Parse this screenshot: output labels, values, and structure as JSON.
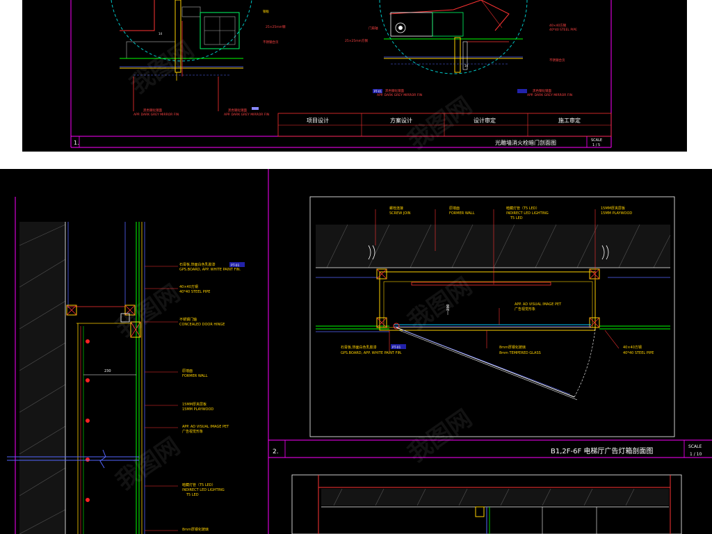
{
  "top_panel": {
    "detail_number": "1.",
    "title": "光雕墙消火栓暗门剖面图",
    "scale_label": "SCALE",
    "scale_value": "1 / 5",
    "sign_cells": [
      "项目设计",
      "方案设计",
      "设计审定",
      "施工审定"
    ],
    "left_circle": {
      "dim_14": "14",
      "dim_25": "25×25mm钢",
      "note_r1": "钢板",
      "note_r2": "不锈钢合页",
      "bottom_tag_cn": "黑色钢化镜面",
      "bottom_tag_en": "APP. DARK GREY MIRROR FIN",
      "bottom_tag_cn_2": "黑色钢化镜面",
      "bottom_tag_en_2": "APP. DARK GREY MIRROR FIN"
    },
    "right_circle": {
      "note_l1": "门扇轴",
      "note_l2": "25×25mm方钢",
      "note_r1_cn": "40×40方钢",
      "note_r1_en": "40*40 STEEL PIPE",
      "note_r2": "不锈钢合页",
      "dim_14": "14",
      "tag_left": "PT-01",
      "bottom_tag_cn": "黑色钢化镜面",
      "bottom_tag_en": "APP. DARK GREY MIRROR FIN",
      "bottom_tag_cn_2": "黑色钢化镜面",
      "bottom_tag_en_2": "APP. DARK GREY MIRROR FIN"
    }
  },
  "bottom_left_panel": {
    "notes": [
      {
        "cn": "石膏板,饰面白色乳胶漆",
        "tag": "PT-01",
        "en": "GPS.BOARD, APP. WHITE PAINT FIN."
      },
      {
        "cn": "40×40方钢",
        "en": "40*40 STEEL PIPE"
      },
      {
        "cn": "不锈钢门轴",
        "en": "CONCEALED DOOR HINGE"
      },
      {
        "cn": "原墙面",
        "en": "FORMER WALL"
      },
      {
        "cn": "15MM厚夹层板",
        "en": "15MM PLAYWOOD"
      },
      {
        "cn": "APP. AD VISUAL IMAGE  PET",
        "en": "广告视觉形象"
      },
      {
        "cn": "暗藏灯管（T5 LED）",
        "en": "INDIRECT LED LIGHTING",
        "en2": "T5 LED"
      },
      {
        "cn": "8mm厚钢化玻璃",
        "en": ""
      }
    ],
    "dim_230": "230"
  },
  "bottom_right_panel": {
    "top_notes": [
      {
        "cn": "螺栓连接",
        "en": "SCREW JOIN"
      },
      {
        "cn": "原墙面",
        "en": "FORMER WALL"
      },
      {
        "cn": "暗藏灯管（T5 LED）",
        "en": "INDIRECT LED LIGHTING",
        "en2": "T5 LED"
      },
      {
        "cn": "15MM厚夹层板",
        "en": "15MM PLAYWOOD"
      }
    ],
    "mid_note": {
      "cn": "APP. AD VISUAL IMAGE  PET",
      "en": "广告视觉形象"
    },
    "dim_230": "230",
    "bottom_notes": [
      {
        "cn": "石膏板,饰面白色乳胶漆",
        "tag": "PT-01",
        "en": "GPS.BOARD, APP. WHITE PAINT FIN."
      },
      {
        "cn": "8mm厚钢化玻璃",
        "en": "8mm TEMPERED GLASS"
      },
      {
        "cn": "40×40方钢",
        "en": "40*40 STEEL PIPE"
      }
    ],
    "detail_number": "2.",
    "title": "B1,2F-6F  电梯厅广告灯箱剖面图",
    "scale_label": "SCALE",
    "scale_value": "1 / 10"
  },
  "watermark": "我图网"
}
